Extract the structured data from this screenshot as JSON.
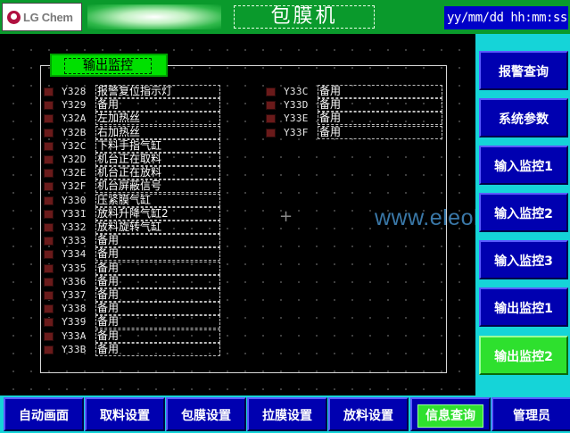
{
  "header": {
    "logo_text": "LG Chem",
    "title": "包膜机",
    "clock": "yy/mm/dd hh:mm:ss"
  },
  "group": {
    "title": "输出监控"
  },
  "outputs_col1": [
    {
      "code": "Y328",
      "desc": "报警复位指示灯"
    },
    {
      "code": "Y329",
      "desc": "备用"
    },
    {
      "code": "Y32A",
      "desc": "左加热丝"
    },
    {
      "code": "Y32B",
      "desc": "右加热丝"
    },
    {
      "code": "Y32C",
      "desc": "下料手指气缸"
    },
    {
      "code": "Y32D",
      "desc": "机台正在取料"
    },
    {
      "code": "Y32E",
      "desc": "机台正在放料"
    },
    {
      "code": "Y32F",
      "desc": "机台屏蔽信号"
    },
    {
      "code": "Y330",
      "desc": "压紧膜气缸"
    },
    {
      "code": "Y331",
      "desc": "放料升降气缸2"
    },
    {
      "code": "Y332",
      "desc": "放料旋转气缸"
    },
    {
      "code": "Y333",
      "desc": "备用"
    },
    {
      "code": "Y334",
      "desc": "备用"
    },
    {
      "code": "Y335",
      "desc": "备用"
    },
    {
      "code": "Y336",
      "desc": "备用"
    },
    {
      "code": "Y337",
      "desc": "备用"
    },
    {
      "code": "Y338",
      "desc": "备用"
    },
    {
      "code": "Y339",
      "desc": "备用"
    },
    {
      "code": "Y33A",
      "desc": "备用"
    },
    {
      "code": "Y33B",
      "desc": "备用"
    }
  ],
  "outputs_col2": [
    {
      "code": "Y33C",
      "desc": "备用"
    },
    {
      "code": "Y33D",
      "desc": "备用"
    },
    {
      "code": "Y33E",
      "desc": "备用"
    },
    {
      "code": "Y33F",
      "desc": "备用"
    }
  ],
  "right_nav": [
    {
      "label": "报警查询"
    },
    {
      "label": "系统参数"
    },
    {
      "label": "输入监控1"
    },
    {
      "label": "输入监控2"
    },
    {
      "label": "输入监控3"
    },
    {
      "label": "输出监控1"
    },
    {
      "label": "输出监控2"
    }
  ],
  "bottom_nav": [
    {
      "label": "自动画面"
    },
    {
      "label": "取料设置"
    },
    {
      "label": "包膜设置"
    },
    {
      "label": "拉膜设置"
    },
    {
      "label": "放料设置"
    },
    {
      "label": "信息查询"
    },
    {
      "label": "管理员"
    }
  ],
  "watermark": "www.eleok.com",
  "colors": {
    "header_green": "#0a9a2c",
    "button_blue": "#0000b0",
    "active_green": "#2ee02e",
    "panel_cyan": "#15d4d8",
    "led_off": "#6a1a1a"
  }
}
